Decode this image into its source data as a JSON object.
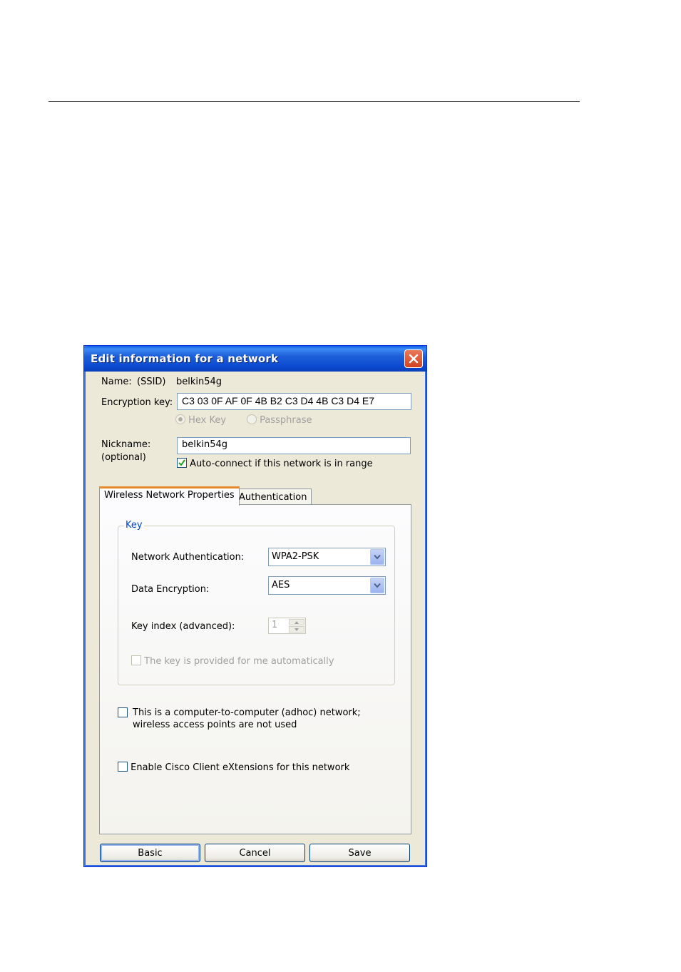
{
  "window": {
    "title": "Edit information for a network",
    "close_label": "×"
  },
  "name_row": {
    "label": "Name:",
    "ssid_label": "(SSID)",
    "ssid_value": "belkin54g"
  },
  "encryption": {
    "label": "Encryption key:",
    "value": "C3 03 0F AF 0F 4B B2 C3 D4 4B C3 D4 E7",
    "hex_key_label": "Hex Key",
    "passphrase_label": "Passphrase"
  },
  "nickname": {
    "label": "Nickname:",
    "optional_label": "(optional)",
    "value": "belkin54g",
    "auto_connect_label": "Auto-connect if this network is in range"
  },
  "tabs": [
    {
      "label": "Wireless Network Properties"
    },
    {
      "label": "Authentication"
    }
  ],
  "key_group": {
    "title": "Key",
    "network_auth_label": "Network Authentication:",
    "network_auth_value": "WPA2-PSK",
    "data_encryption_label": "Data Encryption:",
    "data_encryption_value": "AES",
    "key_index_label": "Key index (advanced):",
    "key_index_value": "1",
    "auto_key_label": "The key is provided for me automatically"
  },
  "adhoc": {
    "line1": "This is a computer-to-computer (adhoc) network;",
    "line2": "wireless access points are not used"
  },
  "cisco": {
    "label": "Enable Cisco Client eXtensions for this network"
  },
  "buttons": {
    "basic": "Basic",
    "cancel": "Cancel",
    "save": "Save"
  },
  "colors": {
    "titlebar": "#0b4ad0",
    "dialog_bg": "#ece9d8",
    "active_tab_accent": "#e68b2c",
    "group_title": "#0046d5",
    "check_mark": "#21a121",
    "close_button": "#d2421f"
  }
}
